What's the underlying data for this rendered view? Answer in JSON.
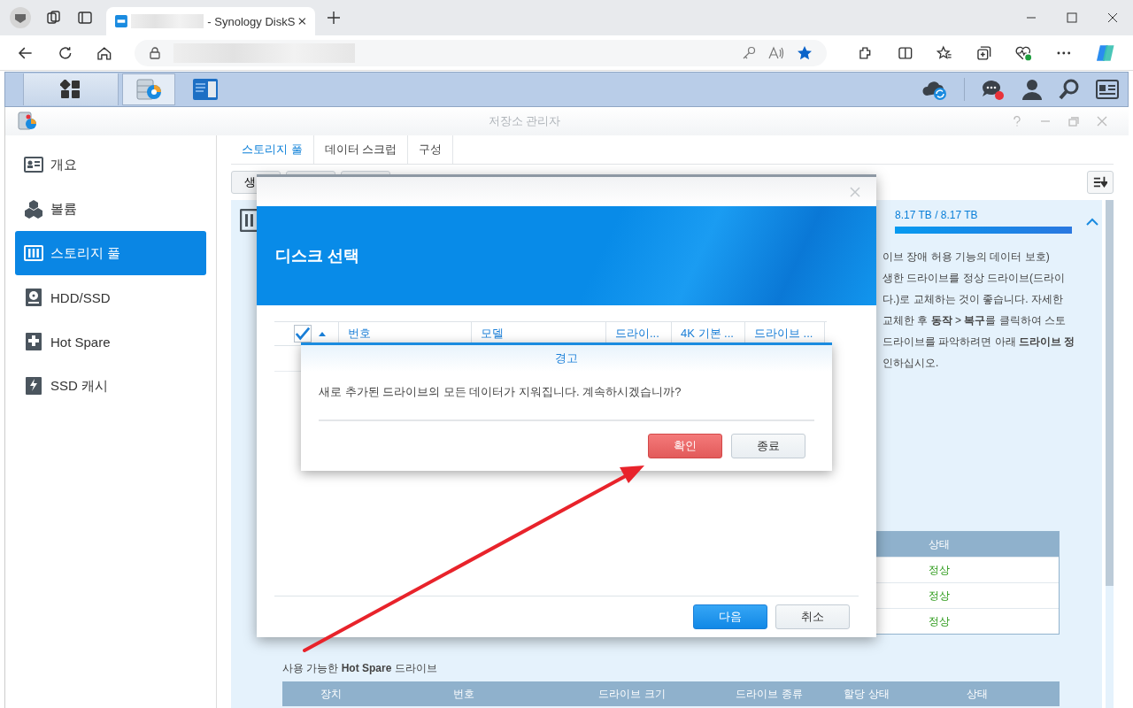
{
  "browser": {
    "tab_title": "- Synology DiskS"
  },
  "taskbar": {
    "apps": [
      {
        "selected": true
      },
      {
        "selected": false
      }
    ]
  },
  "window": {
    "title": "저장소 관리자"
  },
  "sidebar": {
    "items": [
      {
        "label": "개요",
        "selected": false
      },
      {
        "label": "볼륨",
        "selected": false
      },
      {
        "label": "스토리지 풀",
        "selected": true
      },
      {
        "label": "HDD/SSD",
        "selected": false
      },
      {
        "label": "Hot Spare",
        "selected": false
      },
      {
        "label": "SSD 캐시",
        "selected": false
      }
    ]
  },
  "tabs": [
    {
      "label": "스토리지 풀",
      "selected": true
    },
    {
      "label": "데이터 스크럽",
      "selected": false
    },
    {
      "label": "구성",
      "selected": false
    }
  ],
  "toolbar": {
    "first_button": "생"
  },
  "pool": {
    "usage": "8.17 TB / 8.17 TB",
    "level": 1,
    "expanded": true,
    "description": [
      "이브 장애 허용 기능의 데이터 보호)",
      "생한 드라이브를 정상 드라이브(드라이",
      "다.)로 교체하는 것이 좋습니다. 자세한",
      "교체한 후 **동작** > **복구**를 클릭하여 스토",
      "드라이브를 파악하려면 아래 **드라이브 정**",
      "인하십시오."
    ]
  },
  "drives_table": {
    "columns": [
      "상태"
    ],
    "rows": [
      {
        "status": "정상"
      },
      {
        "status": "정상"
      },
      {
        "status": "정상"
      }
    ]
  },
  "hot_spare": {
    "title": "사용 가능한 **Hot Spare** 드라이브",
    "columns": [
      "장치",
      "번호",
      "드라이브 크기",
      "드라이브 종류",
      "할당 상태",
      "상태"
    ]
  },
  "disk_dialog": {
    "title": "디스크 선택",
    "select_all_checked": true,
    "columns": [
      "번호",
      "모델",
      "드라이...",
      "4K 기본 ...",
      "드라이브 ..."
    ],
    "buttons": [
      {
        "label": "다음",
        "kind": "primary"
      },
      {
        "label": "취소",
        "kind": "default"
      }
    ]
  },
  "alert": {
    "title": "경고",
    "message": "새로 추가된 드라이브의 모든 데이터가 지워집니다. 계속하시겠습니까?",
    "buttons": [
      {
        "label": "확인",
        "kind": "danger"
      },
      {
        "label": "종료",
        "kind": "default"
      }
    ]
  }
}
